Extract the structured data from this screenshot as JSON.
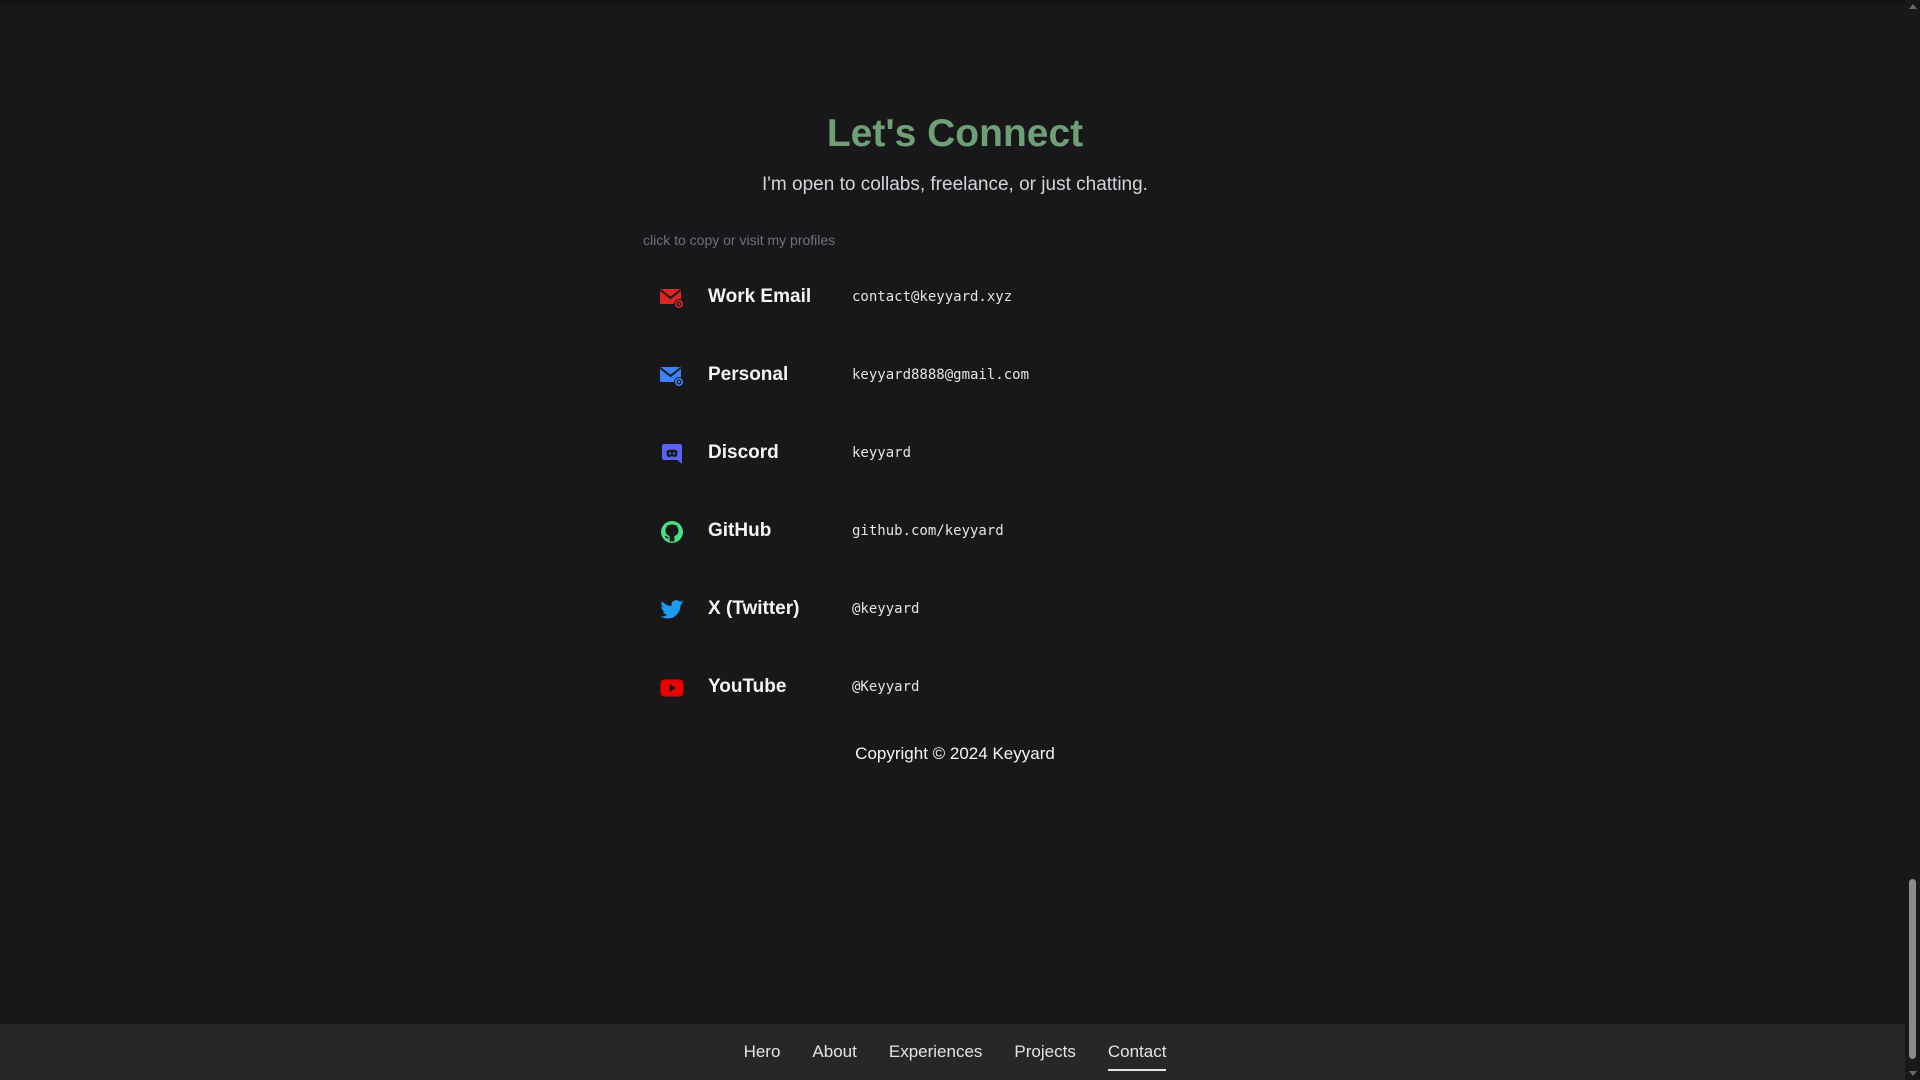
{
  "contact": {
    "title": "Let's Connect",
    "subtitle": "I'm open to collabs, freelance, or just chatting.",
    "hint": "click to copy or visit my profiles",
    "rows": [
      {
        "icon": "email-icon",
        "label": "Work Email",
        "value": "contact@keyyard.xyz",
        "color": "#dc2626"
      },
      {
        "icon": "email-icon",
        "label": "Personal",
        "value": "keyyard8888@gmail.com",
        "color": "#3b82f6"
      },
      {
        "icon": "discord-icon",
        "label": "Discord",
        "value": "keyyard",
        "color": "#5865f2"
      },
      {
        "icon": "github-icon",
        "label": "GitHub",
        "value": "github.com/keyyard",
        "color": "#4ade80"
      },
      {
        "icon": "twitter-icon",
        "label": "X (Twitter)",
        "value": "@keyyard",
        "color": "#1d9bf0"
      },
      {
        "icon": "youtube-icon",
        "label": "YouTube",
        "value": "@Keyyard",
        "color": "#ef0000"
      }
    ],
    "copyright": "Copyright © 2024 Keyyard"
  },
  "nav": {
    "items": [
      "Hero",
      "About",
      "Experiences",
      "Projects",
      "Contact"
    ],
    "active": "Contact"
  },
  "colors": {
    "background": "#18181b",
    "accent_title": "#6f9f74",
    "nav_background": "#27272a"
  }
}
